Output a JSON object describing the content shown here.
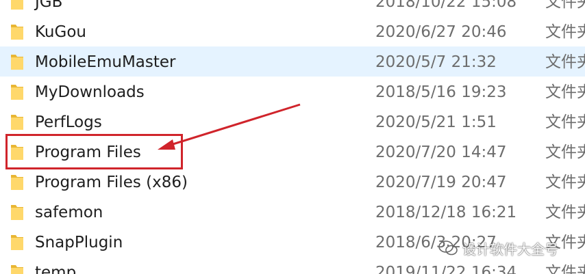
{
  "rows": [
    {
      "name": "JGB",
      "date": "2018/10/22 15:08",
      "type": "文件夹",
      "icon": "folder-icon"
    },
    {
      "name": "KuGou",
      "date": "2020/6/27 20:46",
      "type": "文件夹",
      "icon": "folder-icon"
    },
    {
      "name": "MobileEmuMaster",
      "date": "2020/5/7 21:32",
      "type": "文件夹",
      "icon": "folder-icon",
      "hovered": true
    },
    {
      "name": "MyDownloads",
      "date": "2018/5/16 19:23",
      "type": "文件夹",
      "icon": "folder-icon"
    },
    {
      "name": "PerfLogs",
      "date": "2020/5/21 1:51",
      "type": "文件夹",
      "icon": "folder-icon"
    },
    {
      "name": "Program Files",
      "date": "2020/7/20 14:47",
      "type": "文件夹",
      "icon": "folder-icon",
      "highlighted": true
    },
    {
      "name": "Program Files (x86)",
      "date": "2020/7/19 20:47",
      "type": "文件夹",
      "icon": "folder-icon"
    },
    {
      "name": "safemon",
      "date": "2018/12/18 16:21",
      "type": "文件夹",
      "icon": "folder-icon"
    },
    {
      "name": "SnapPlugin",
      "date": "2018/6/3 20:27",
      "type": "文件夹",
      "icon": "folder-icon"
    },
    {
      "name": "temp",
      "date": "2019/11/22 16:34",
      "type": "文件夹",
      "icon": "folder-icon"
    }
  ],
  "annotation": {
    "highlight_color": "#d0242b",
    "arrow_color": "#d0242b"
  },
  "watermark": {
    "text": "设计软件大全号",
    "icon": "wechat-icon"
  },
  "colors": {
    "hover_background": "#e5f3ff",
    "folder_yellow": "#f8d775"
  }
}
